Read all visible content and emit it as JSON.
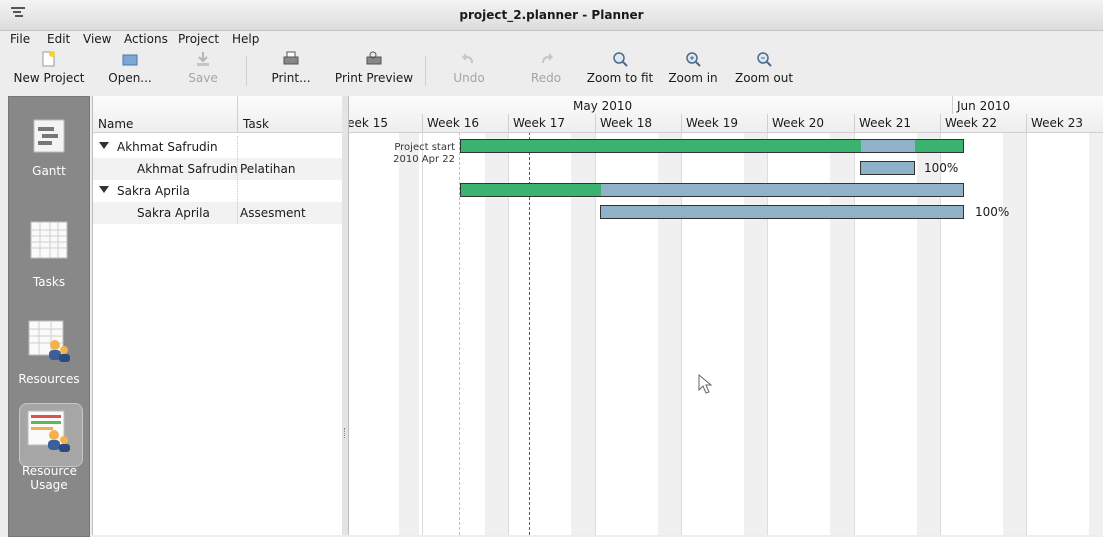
{
  "window": {
    "title": "project_2.planner - Planner"
  },
  "menu": [
    "File",
    "Edit",
    "View",
    "Actions",
    "Project",
    "Help"
  ],
  "toolbar": {
    "new_project": "New Project",
    "open": "Open...",
    "save": "Save",
    "print": "Print...",
    "print_preview": "Print Preview",
    "undo": "Undo",
    "redo": "Redo",
    "zoom_to_fit": "Zoom to fit",
    "zoom_in": "Zoom in",
    "zoom_out": "Zoom out"
  },
  "sidebar": {
    "items": [
      {
        "label": "Gantt",
        "icon": "gantt-icon"
      },
      {
        "label": "Tasks",
        "icon": "tasks-icon"
      },
      {
        "label": "Resources",
        "icon": "resources-icon"
      },
      {
        "label": "Resource Usage",
        "icon": "resource-usage-icon"
      }
    ],
    "selected": "Resource Usage"
  },
  "usage_table": {
    "columns": [
      "Name",
      "Task"
    ],
    "rows": [
      {
        "name": "Akhmat Safrudin",
        "task": "",
        "group": true
      },
      {
        "name": "Akhmat Safrudin",
        "task": "Pelatihan",
        "group": false
      },
      {
        "name": "Sakra Aprila",
        "task": "",
        "group": true
      },
      {
        "name": "Sakra Aprila",
        "task": "Assesment",
        "group": false
      }
    ]
  },
  "chart": {
    "months": [
      "May 2010",
      "Jun 2010"
    ],
    "weeks": [
      "Week 15",
      "Week 16",
      "Week 17",
      "Week 18",
      "Week 19",
      "Week 20",
      "Week 21",
      "Week 22",
      "Week 23"
    ],
    "project_start_label": "Project start",
    "project_start_date": "2010 Apr 22",
    "assignments": [
      {
        "percent": "100%"
      },
      {
        "percent": "100%"
      }
    ]
  },
  "colors": {
    "summary_bar": "#3cb270",
    "task_bar": "#8fb2c8",
    "sidebar": "#888888"
  }
}
